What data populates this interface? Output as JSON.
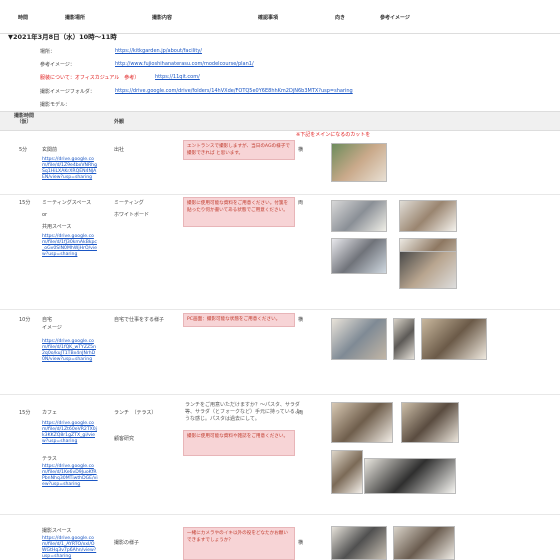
{
  "header": {
    "time": "時間",
    "place": "撮影場所",
    "content": "撮影内容",
    "notes": "確認事項",
    "orientation": "向き",
    "ref": "参考イメージ"
  },
  "date_line": "▼2021年3月8日（水）10時～11時",
  "info": [
    {
      "label": "場所：",
      "value": "https://kitkgarden.jp/about/facility/",
      "link": true
    },
    {
      "label": "参考イメージ：",
      "value": "http://www.fujioshihanaterasu.com/modelcourse/plan1/",
      "link": true
    },
    {
      "label": "服装について：オフィスカジュアル　参考）",
      "value": "https://11qit.com/",
      "link": true,
      "red": true
    },
    {
      "label": "撮影イメージフォルダ：",
      "value": "https://drive.google.com/drive/folders/14hVXde/FOTQ5e0Y6E8hhKm2DjN6b3MTX?usp=sharing",
      "link": true
    },
    {
      "label": "撮影モデル：",
      "value": "",
      "link": false
    }
  ],
  "table_header": {
    "time": "撮影時間\n（仮）",
    "outer": "外観"
  },
  "note_text": "※下記をメインになるのカットを",
  "rows": [
    {
      "time": "5分",
      "place": "玄関前",
      "place_link": "https://drive.google.com/file/d/1Z9e4bxVNRhgSq1HiLXAKrXRQEN4NJAEN/view?usp=sharing",
      "content": "出社",
      "box": "エントランスで撮影しますが、当日のAGの様子で撮影できれば と思います。",
      "dir": "横"
    },
    {
      "time": "15分",
      "place": "ミーティングスペース",
      "place2": "or",
      "place3": "共用スペース",
      "place_link": "https://drive.google.com/file/d/1fJ30kmAkBkpc_oGv0SIN0MhWjHrO/view?usp=sharing",
      "content": "ミーティング",
      "content2": "ホワイトボード",
      "box": "撮影に使用可能な資料をご用意ください。付箋を貼ったり何か書いてある状態でご用意ください。",
      "dir": "両"
    },
    {
      "time": "10分",
      "place": "自宅",
      "place2": "イメージ",
      "place_link": "https://drive.google.com/file/d/1fQK_wTYZZ5n2q0o/kuJT1TBx4nJNrhD0N/view?usp=sharing",
      "content": "自宅で仕事をする様子",
      "box": "PC画面：撮影可能な状態をご用意ください。",
      "dir": "横"
    },
    {
      "time": "15分",
      "place": "カフェ",
      "place_link": "https://drive.google.com/file/d/1Zt60eVR2TX0jk3KKZQ8r1gZTX_gi/view?usp=sharing",
      "place3": "テラス",
      "place_link2": "https://drive.google.com/file/d/1Ke6vD9JuoKfRPbnNhq30MTiwthDGE/view?usp=sharing",
      "content": "ランチ　（テラス）",
      "content2": "顧客研究",
      "box": "ランチをご用意いただけますか？～パスタ、サラダ等、サラダ（とフォークなど）手元に持っているような感じ。パスタは過去にして。",
      "box2": "撮影に使用可能な資料や雑誌をご用意ください。",
      "dir": "両"
    },
    {
      "time": "",
      "place": "撮影スペース",
      "place_link": "https://drive.google.com/file/d/1_AYRTO/xxl/OWGtHq3v7p6Ahn/view?usp=sharing",
      "content": "撮影の様子",
      "box": "一緒にカメラやのイキ以外の役をどなたかお願いできますでしょうか？",
      "dir": "横"
    }
  ]
}
